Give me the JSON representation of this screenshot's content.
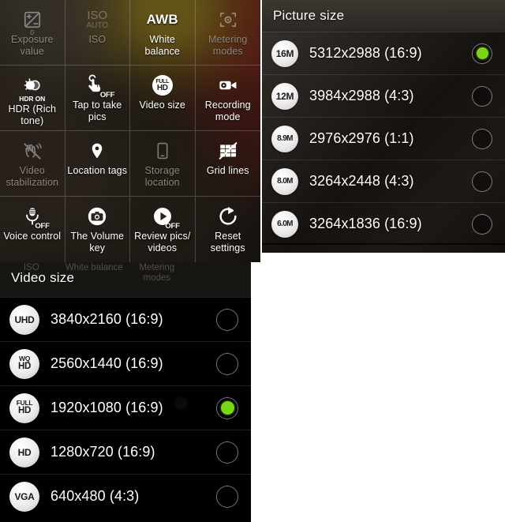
{
  "settings_grid": {
    "name": "camera-settings-grid",
    "items": [
      {
        "label": "Exposure value",
        "icon": "exposure-value-icon",
        "enabled": false,
        "icon_kind": "exposure",
        "sub": "0"
      },
      {
        "label": "ISO",
        "icon": "iso-icon",
        "enabled": false,
        "icon_kind": "iso",
        "icon_text": "ISO",
        "icon_sub": "AUTO"
      },
      {
        "label": "White balance",
        "icon": "white-balance-icon",
        "enabled": true,
        "icon_kind": "awb",
        "icon_text": "AWB"
      },
      {
        "label": "Metering modes",
        "icon": "metering-modes-icon",
        "enabled": false,
        "icon_kind": "metering"
      },
      {
        "label": "HDR (Rich tone)",
        "icon": "hdr-icon",
        "enabled": true,
        "icon_kind": "hdr",
        "badge": "HDR ON"
      },
      {
        "label": "Tap to take pics",
        "icon": "tap-to-take-pics-icon",
        "enabled": true,
        "icon_kind": "tap",
        "badge_off": "OFF"
      },
      {
        "label": "Video size",
        "icon": "video-size-icon",
        "enabled": true,
        "icon_kind": "fullhd"
      },
      {
        "label": "Recording mode",
        "icon": "recording-mode-icon",
        "enabled": true,
        "icon_kind": "camcorder"
      },
      {
        "label": "Video stabilization",
        "icon": "video-stabilization-icon",
        "enabled": false,
        "icon_kind": "stabilization"
      },
      {
        "label": "Location tags",
        "icon": "location-tags-icon",
        "enabled": true,
        "icon_kind": "pin"
      },
      {
        "label": "Storage location",
        "icon": "storage-location-icon",
        "enabled": false,
        "icon_kind": "phone"
      },
      {
        "label": "Grid lines",
        "icon": "grid-lines-icon",
        "enabled": true,
        "icon_kind": "gridlines"
      },
      {
        "label": "Voice control",
        "icon": "voice-control-icon",
        "enabled": true,
        "icon_kind": "mic",
        "badge_off": "OFF"
      },
      {
        "label": "The Volume key",
        "icon": "volume-key-icon",
        "enabled": true,
        "icon_kind": "camera"
      },
      {
        "label": "Review pics/ videos",
        "icon": "review-pics-videos-icon",
        "enabled": true,
        "icon_kind": "play",
        "badge_off": "OFF"
      },
      {
        "label": "Reset settings",
        "icon": "reset-settings-icon",
        "enabled": true,
        "icon_kind": "reset"
      }
    ]
  },
  "picture_size": {
    "title": "Picture size",
    "options": [
      {
        "badge": "16M",
        "badge_lines": [
          "",
          "16M"
        ],
        "label": "5312x2988 (16:9)",
        "selected": true
      },
      {
        "badge": "12M",
        "badge_lines": [
          "",
          "12M"
        ],
        "label": "3984x2988 (4:3)",
        "selected": false
      },
      {
        "badge": "8.9M",
        "badge_lines": [
          "",
          "8.9M"
        ],
        "label": "2976x2976 (1:1)",
        "selected": false
      },
      {
        "badge": "8.0M",
        "badge_lines": [
          "",
          "8.0M"
        ],
        "label": "3264x2448 (4:3)",
        "selected": false
      },
      {
        "badge": "6.0M",
        "badge_lines": [
          "",
          "6.0M"
        ],
        "label": "3264x1836 (16:9)",
        "selected": false
      }
    ]
  },
  "video_size": {
    "title": "Video size",
    "ghost_labels": [
      "ISO",
      "White balance",
      "Metering modes",
      ""
    ],
    "options": [
      {
        "badge": "UHD",
        "badge_lines": [
          "",
          "UHD"
        ],
        "label": "3840x2160 (16:9)",
        "selected": false
      },
      {
        "badge": "WQHD",
        "badge_lines": [
          "WQ",
          "HD"
        ],
        "label": "2560x1440 (16:9)",
        "selected": false
      },
      {
        "badge": "FULLHD",
        "badge_lines": [
          "FULL",
          "HD"
        ],
        "label": "1920x1080 (16:9)",
        "selected": true
      },
      {
        "badge": "HD",
        "badge_lines": [
          "",
          "HD"
        ],
        "label": "1280x720 (16:9)",
        "selected": false
      },
      {
        "badge": "VGA",
        "badge_lines": [
          "",
          "VGA"
        ],
        "label": "640x480 (4:3)",
        "selected": false
      }
    ]
  },
  "colors": {
    "selected_green": "#78d816",
    "panel_bg": "#151210",
    "text_primary": "#ffffff",
    "text_disabled": "#8d867e"
  }
}
